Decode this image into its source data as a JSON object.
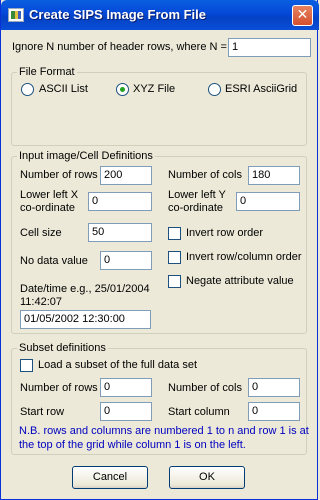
{
  "window": {
    "title": "Create SIPS Image From File",
    "close_glyph": "✕"
  },
  "header_rows": {
    "label": "Ignore N number of header rows, where N =",
    "value": "1"
  },
  "file_format": {
    "group_label": "File Format",
    "options": [
      {
        "label": "ASCII List",
        "selected": false
      },
      {
        "label": "XYZ File",
        "selected": true
      },
      {
        "label": "ESRI AsciiGrid",
        "selected": false
      }
    ]
  },
  "input_defs": {
    "group_label": "Input image/Cell Definitions",
    "num_rows_label": "Number of rows",
    "num_rows_value": "200",
    "num_cols_label": "Number of cols",
    "num_cols_value": "180",
    "lower_left_x_label_1": "Lower left X",
    "lower_left_x_label_2": "co-ordinate",
    "lower_left_x_value": "0",
    "lower_left_y_label_1": "Lower left Y",
    "lower_left_y_label_2": "co-ordinate",
    "lower_left_y_value": "0",
    "cell_size_label": "Cell size",
    "cell_size_value": "50",
    "no_data_label": "No data value",
    "no_data_value": "0",
    "datetime_label_1": "Date/time e.g., 25/01/2004",
    "datetime_label_2": "11:42:07",
    "datetime_value": "01/05/2002 12:30:00",
    "invert_row_order": {
      "label": "Invert row order",
      "checked": false
    },
    "invert_row_col_order": {
      "label": "Invert row/column order",
      "checked": false
    },
    "negate_attribute": {
      "label": "Negate attribute value",
      "checked": false
    }
  },
  "subset": {
    "group_label": "Subset definitions",
    "load_subset": {
      "label": "Load a subset of the full data set",
      "checked": false
    },
    "num_rows_label": "Number of rows",
    "num_rows_value": "0",
    "num_cols_label": "Number of cols",
    "num_cols_value": "0",
    "start_row_label": "Start row",
    "start_row_value": "0",
    "start_col_label": "Start column",
    "start_col_value": "0",
    "note": "N.B. rows and columns are numbered 1 to n and row 1 is at the top of the grid while column 1 is on the left."
  },
  "buttons": {
    "cancel": "Cancel",
    "ok": "OK"
  },
  "colors": {
    "titlebar": "#0548d8",
    "window_bg": "#ece9d8",
    "note_text": "#0000c0"
  },
  "icons": {
    "app": "sips-image-icon",
    "close": "close-icon"
  }
}
